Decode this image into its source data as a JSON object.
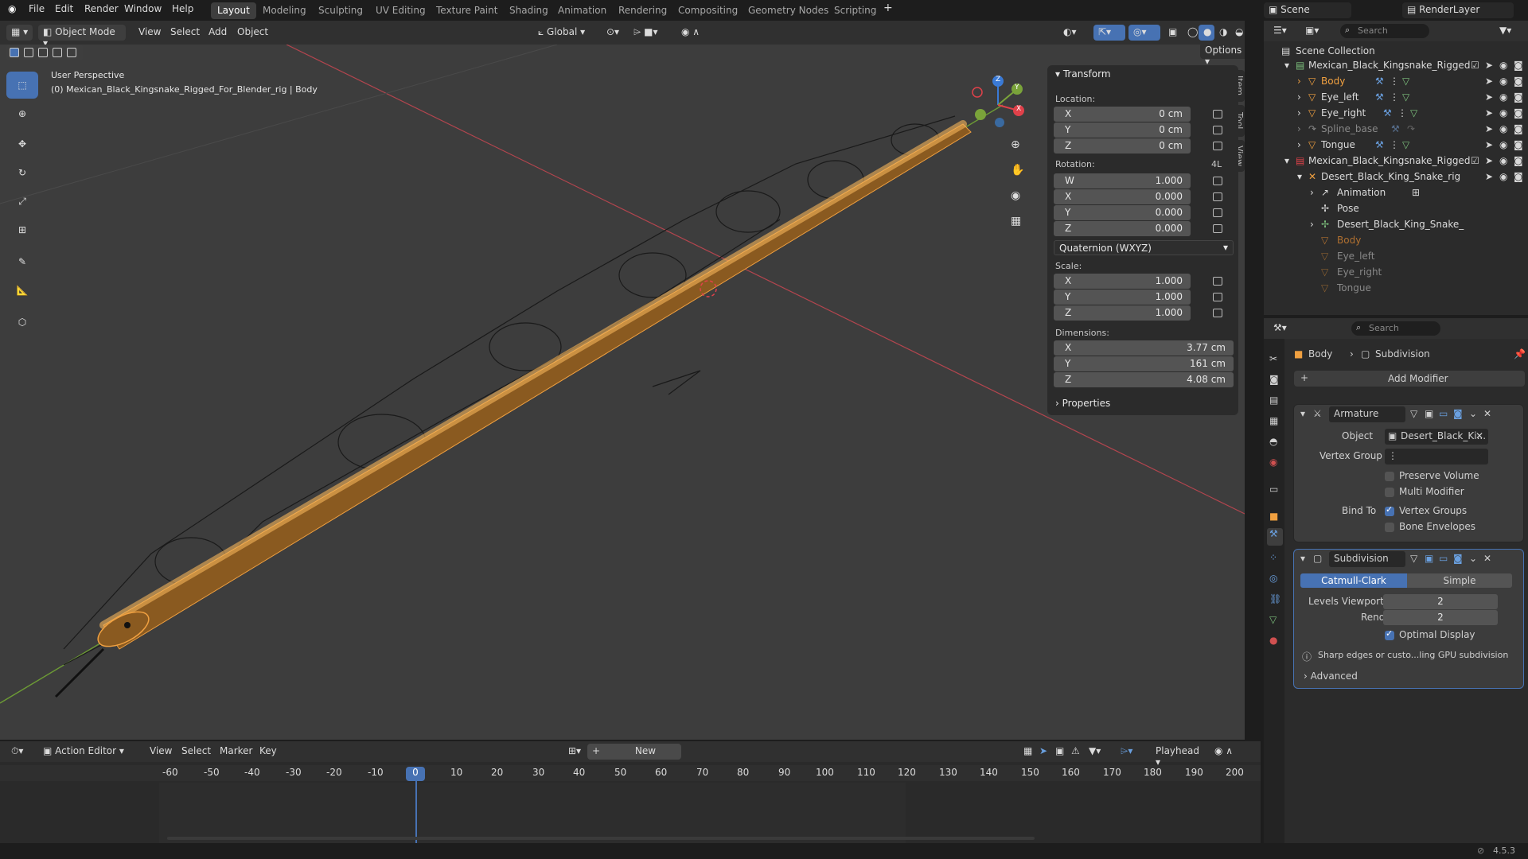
{
  "menu": {
    "file": "File",
    "edit": "Edit",
    "render": "Render",
    "window": "Window",
    "help": "Help"
  },
  "workspaces": [
    "Layout",
    "Modeling",
    "Sculpting",
    "UV Editing",
    "Texture Paint",
    "Shading",
    "Animation",
    "Rendering",
    "Compositing",
    "Geometry Nodes",
    "Scripting"
  ],
  "active_workspace": "Layout",
  "scene_name": "Scene",
  "render_layer": "RenderLayer",
  "viewport_header": {
    "mode": "Object Mode",
    "view": "View",
    "select": "Select",
    "add": "Add",
    "object": "Object",
    "orientation": "Global",
    "options": "Options"
  },
  "viewport": {
    "perspective": "User Perspective",
    "object_info": "(0) Mexican_Black_Kingsnake_Rigged_For_Blender_rig | Body"
  },
  "gizmo": {
    "x": "X",
    "y": "Y",
    "z": "Z"
  },
  "npanel": {
    "transform": "Transform",
    "location_label": "Location:",
    "location": [
      {
        "axis": "X",
        "value": "0 cm"
      },
      {
        "axis": "Y",
        "value": "0 cm"
      },
      {
        "axis": "Z",
        "value": "0 cm"
      }
    ],
    "rotation_label": "Rotation:",
    "rotation_mode_tag": "4L",
    "rotation": [
      {
        "axis": "W",
        "value": "1.000"
      },
      {
        "axis": "X",
        "value": "0.000"
      },
      {
        "axis": "Y",
        "value": "0.000"
      },
      {
        "axis": "Z",
        "value": "0.000"
      }
    ],
    "rotation_mode": "Quaternion (WXYZ)",
    "scale_label": "Scale:",
    "scale": [
      {
        "axis": "X",
        "value": "1.000"
      },
      {
        "axis": "Y",
        "value": "1.000"
      },
      {
        "axis": "Z",
        "value": "1.000"
      }
    ],
    "dimensions_label": "Dimensions:",
    "dimensions": [
      {
        "axis": "X",
        "value": "3.77 cm"
      },
      {
        "axis": "Y",
        "value": "161 cm"
      },
      {
        "axis": "Z",
        "value": "4.08 cm"
      }
    ],
    "properties": "Properties",
    "tabs": [
      "Item",
      "Tool",
      "View"
    ]
  },
  "outliner": {
    "search_placeholder": "Search",
    "rows": [
      {
        "label": "Scene Collection"
      },
      {
        "label": "Mexican_Black_Kingsnake_Rigged"
      },
      {
        "label": "Body"
      },
      {
        "label": "Eye_left"
      },
      {
        "label": "Eye_right"
      },
      {
        "label": "Spline_base"
      },
      {
        "label": "Tongue"
      },
      {
        "label": "Mexican_Black_Kingsnake_Rigged"
      },
      {
        "label": "Desert_Black_King_Snake_rig"
      },
      {
        "label": "Animation"
      },
      {
        "label": "Pose"
      },
      {
        "label": "Desert_Black_King_Snake_"
      },
      {
        "label": "Body"
      },
      {
        "label": "Eye_left"
      },
      {
        "label": "Eye_right"
      },
      {
        "label": "Tongue"
      }
    ]
  },
  "properties": {
    "search_placeholder": "Search",
    "breadcrumb_object": "Body",
    "breadcrumb_modifier": "Subdivision",
    "add_modifier": "Add Modifier",
    "armature": {
      "name": "Armature",
      "object_label": "Object",
      "object_value": "Desert_Black_Ki...",
      "vertex_group_label": "Vertex Group",
      "preserve_volume": "Preserve Volume",
      "multi_modifier": "Multi Modifier",
      "bind_to_label": "Bind To",
      "vertex_groups": "Vertex Groups",
      "bone_envelopes": "Bone Envelopes"
    },
    "subdivision": {
      "name": "Subdivision",
      "catmull": "Catmull-Clark",
      "simple": "Simple",
      "levels_viewport_label": "Levels Viewport",
      "levels_viewport": "2",
      "render_label": "Render",
      "render": "2",
      "optimal_display": "Optimal Display",
      "info": "Sharp edges or custo...ling GPU subdivision",
      "advanced": "Advanced"
    }
  },
  "timeline": {
    "editor": "Action Editor",
    "view": "View",
    "select": "Select",
    "marker": "Marker",
    "key": "Key",
    "new": "New",
    "playhead": "Playhead",
    "current_frame": "0",
    "ticks": [
      "-60",
      "-50",
      "-40",
      "-30",
      "-20",
      "-10",
      "0",
      "10",
      "20",
      "30",
      "40",
      "50",
      "60",
      "70",
      "80",
      "90",
      "100",
      "110",
      "120",
      "130",
      "140",
      "150",
      "160",
      "170",
      "180",
      "190",
      "200"
    ]
  },
  "status": {
    "version": "4.5.3"
  },
  "colors": {
    "accent": "#4772b3",
    "selection_orange": "#f0a040",
    "x_axis": "#e0414a",
    "y_axis": "#7aa33a",
    "z_axis": "#3a7ad6"
  }
}
